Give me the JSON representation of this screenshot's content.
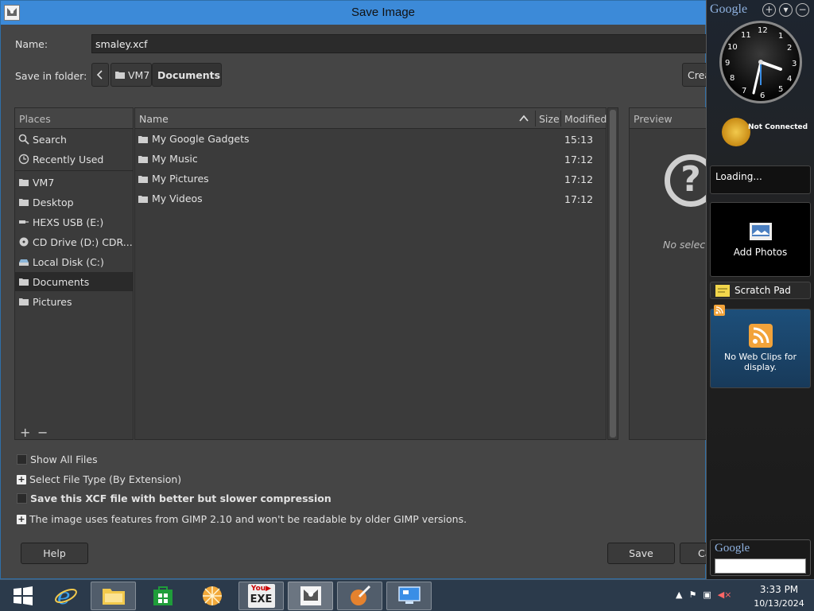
{
  "window": {
    "title": "Save Image"
  },
  "name_field": {
    "label": "Name:",
    "value": "smaley.xcf"
  },
  "folder": {
    "label": "Save in folder:",
    "breadcrumbs": [
      "VM7",
      "Documents"
    ],
    "create_folder_label": "Create Folder"
  },
  "places": {
    "header": "Places",
    "items": [
      {
        "label": "Search",
        "icon": "search-icon"
      },
      {
        "label": "Recently Used",
        "icon": "clock-icon"
      },
      {
        "label": "VM7",
        "icon": "folder-icon"
      },
      {
        "label": "Desktop",
        "icon": "folder-icon"
      },
      {
        "label": "HEXS USB (E:)",
        "icon": "usb-drive-icon"
      },
      {
        "label": "CD Drive (D:) CDR...",
        "icon": "optical-drive-icon"
      },
      {
        "label": "Local Disk (C:)",
        "icon": "hard-disk-icon"
      },
      {
        "label": "Documents",
        "icon": "folder-icon",
        "selected": true
      },
      {
        "label": "Pictures",
        "icon": "folder-icon"
      }
    ],
    "add_symbol": "+",
    "remove_symbol": "−"
  },
  "files": {
    "columns": {
      "name": "Name",
      "size": "Size",
      "modified": "Modified"
    },
    "rows": [
      {
        "name": "My Google Gadgets",
        "modified": "15:13"
      },
      {
        "name": "My Music",
        "modified": "17:12"
      },
      {
        "name": "My Pictures",
        "modified": "17:12"
      },
      {
        "name": "My Videos",
        "modified": "17:12"
      }
    ]
  },
  "preview": {
    "header": "Preview",
    "no_selection": "No selection"
  },
  "options": {
    "show_all_files": "Show All Files",
    "select_file_type": "Select File Type (By Extension)",
    "compression": "Save this XCF file with better but slower compression",
    "compat_note": "The image uses features from GIMP 2.10 and won't be readable by older GIMP versions."
  },
  "buttons": {
    "help": "Help",
    "save": "Save",
    "cancel": "Cancel"
  },
  "sidebar": {
    "logo": "Google",
    "controls": [
      "+",
      "▾",
      "−"
    ],
    "clock_numbers": [
      "12",
      "1",
      "2",
      "3",
      "4",
      "5",
      "6",
      "7",
      "8",
      "9",
      "10",
      "11"
    ],
    "weather_status": "Not Connected",
    "loading_text": "Loading...",
    "photos_label": "Add Photos",
    "scratch_pad_label": "Scratch Pad",
    "web_clips_text": "No Web Clips for display.",
    "search_logo": "Google"
  },
  "taskbar": {
    "apps": [
      "start",
      "internet-explorer",
      "file-explorer",
      "store",
      "app-orange",
      "youtube-exe",
      "gimp",
      "paint",
      "remote-desktop"
    ],
    "youtube_label": "EXE",
    "time": "3:33 PM",
    "date": "10/13/2024"
  },
  "colors": {
    "titlebar": "#3c8ad8",
    "dialog_bg": "#454545",
    "panel_bg": "#3b3b3b",
    "taskbar": "#2b3a4b"
  }
}
